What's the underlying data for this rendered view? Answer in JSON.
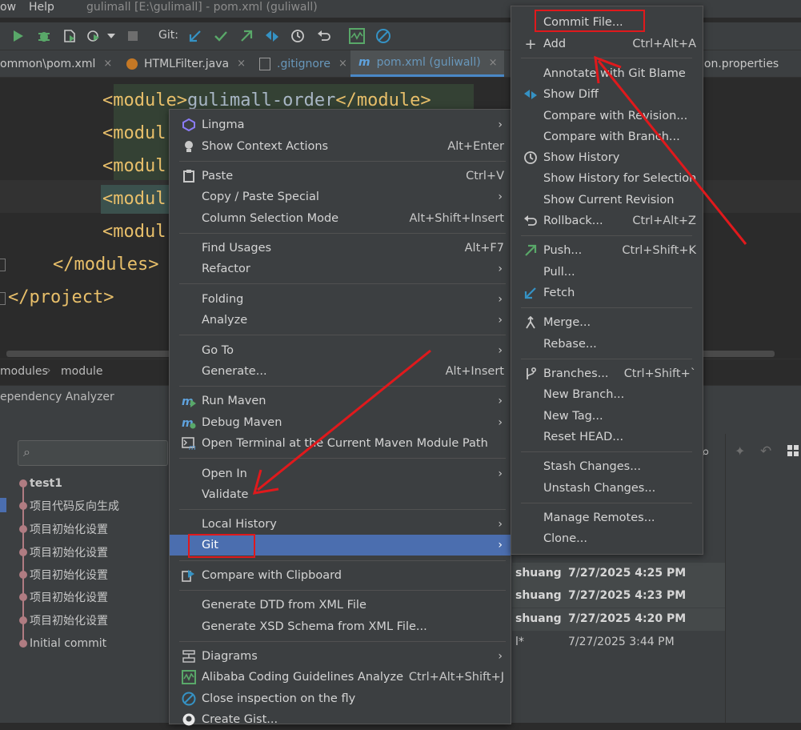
{
  "titlebar": {
    "menu_view": "ow",
    "menu_help": "Help",
    "title": "gulimall [E:\\gulimall] - pom.xml (guliwall)"
  },
  "toolbar": {
    "git_label": "Git:"
  },
  "tabs": [
    {
      "label": "ommon\\pom.xml"
    },
    {
      "label": "HTMLFilter.java"
    },
    {
      "label": ".gitignore"
    },
    {
      "label": "pom.xml (guliwall)"
    },
    {
      "label": "ion.properties"
    }
  ],
  "editor": {
    "lines": [
      {
        "open": "<module>",
        "text": "gulimall-order",
        "close": "</module>"
      },
      {
        "open": "<modul",
        "text": "",
        "close": ""
      },
      {
        "open": "<modul",
        "text": "",
        "close": ""
      },
      {
        "open": "<modul",
        "text": "",
        "close": ""
      },
      {
        "open": "<modul",
        "text": "",
        "close": ""
      },
      {
        "open": "</modules>",
        "text": "",
        "close": ""
      },
      {
        "open": "</project>",
        "text": "",
        "close": ""
      }
    ]
  },
  "breadcrumbs": {
    "item1": "modules",
    "sep": "›",
    "item2": "module"
  },
  "dependency_panel": {
    "label": "ependency Analyzer"
  },
  "gitlog": {
    "rows": [
      {
        "msg": "test1",
        "bold": true
      },
      {
        "msg": "项目代码反向生成"
      },
      {
        "msg": "项目初始化设置"
      },
      {
        "msg": "项目初始化设置"
      },
      {
        "msg": "项目初始化设置"
      },
      {
        "msg": "项目初始化设置"
      },
      {
        "msg": "项目初始化设置"
      },
      {
        "msg": "Initial commit"
      }
    ],
    "right_rows": [
      {
        "author": "shuang",
        "date": "7/27/2025 4:25 PM"
      },
      {
        "author": "shuang",
        "date": "7/27/2025 4:23 PM"
      },
      {
        "author": "shuang",
        "date": "7/27/2025 4:20 PM"
      },
      {
        "author": "l*",
        "date": "7/27/2025 3:44 PM"
      }
    ]
  },
  "context_menu": {
    "items": [
      {
        "label": "Lingma",
        "shortcut": "",
        "submenu": true,
        "icon": "lingma-icon"
      },
      {
        "label": "Show Context Actions",
        "shortcut": "Alt+Enter",
        "icon": "bulb-icon"
      },
      {
        "label": "Paste",
        "shortcut": "Ctrl+V",
        "icon": "clipboard-icon"
      },
      {
        "label": "Copy / Paste Special",
        "submenu": true
      },
      {
        "label": "Column Selection Mode",
        "shortcut": "Alt+Shift+Insert"
      },
      {
        "label": "Find Usages",
        "shortcut": "Alt+F7"
      },
      {
        "label": "Refactor",
        "submenu": true
      },
      {
        "label": "Folding",
        "submenu": true
      },
      {
        "label": "Analyze",
        "submenu": true
      },
      {
        "label": "Go To",
        "submenu": true
      },
      {
        "label": "Generate...",
        "shortcut": "Alt+Insert"
      },
      {
        "label": "Run Maven",
        "submenu": true,
        "icon": "maven-run-icon"
      },
      {
        "label": "Debug Maven",
        "submenu": true,
        "icon": "maven-debug-icon"
      },
      {
        "label": "Open Terminal at the Current Maven Module Path",
        "icon": "terminal-icon"
      },
      {
        "label": "Open In",
        "submenu": true
      },
      {
        "label": "Validate"
      },
      {
        "label": "Local History",
        "submenu": true
      },
      {
        "label": "Git",
        "submenu": true,
        "highlighted": true
      },
      {
        "label": "Compare with Clipboard",
        "icon": "compare-icon"
      },
      {
        "label": "Generate DTD from XML File"
      },
      {
        "label": "Generate XSD Schema from XML File..."
      },
      {
        "label": "Diagrams",
        "submenu": true,
        "icon": "diagram-icon"
      },
      {
        "label": "Alibaba Coding Guidelines Analyze",
        "shortcut": "Ctrl+Alt+Shift+J",
        "icon": "alibaba-icon"
      },
      {
        "label": "Close inspection on the fly",
        "icon": "no-icon"
      },
      {
        "label": "Create Gist...",
        "icon": "github-icon"
      }
    ]
  },
  "git_submenu": {
    "items": [
      {
        "label": "Commit File...",
        "shortcut": ""
      },
      {
        "label": "Add",
        "shortcut": "Ctrl+Alt+A",
        "icon": "plus-icon"
      },
      {
        "label": "Annotate with Git Blame"
      },
      {
        "label": "Show Diff",
        "icon": "diff-icon"
      },
      {
        "label": "Compare with Revision..."
      },
      {
        "label": "Compare with Branch..."
      },
      {
        "label": "Show History",
        "icon": "clock-icon"
      },
      {
        "label": "Show History for Selection"
      },
      {
        "label": "Show Current Revision"
      },
      {
        "label": "Rollback...",
        "shortcut": "Ctrl+Alt+Z",
        "icon": "rollback-icon"
      },
      {
        "label": "Push...",
        "shortcut": "Ctrl+Shift+K",
        "icon": "push-icon"
      },
      {
        "label": "Pull..."
      },
      {
        "label": "Fetch",
        "icon": "fetch-icon"
      },
      {
        "label": "Merge...",
        "icon": "merge-icon"
      },
      {
        "label": "Rebase..."
      },
      {
        "label": "Branches...",
        "shortcut": "Ctrl+Shift+`",
        "icon": "branch-icon"
      },
      {
        "label": "New Branch..."
      },
      {
        "label": "New Tag..."
      },
      {
        "label": "Reset HEAD..."
      },
      {
        "label": "Stash Changes..."
      },
      {
        "label": "Unstash Changes..."
      },
      {
        "label": "Manage Remotes..."
      },
      {
        "label": "Clone..."
      }
    ]
  },
  "colors": {
    "annotation_red": "#e0191c",
    "highlight_blue": "#4b6eaf",
    "menu_bg": "#3c3f41"
  }
}
